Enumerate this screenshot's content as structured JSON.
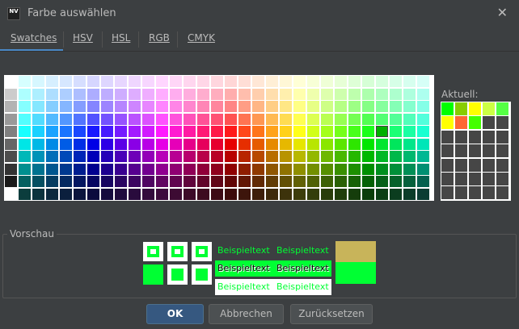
{
  "window": {
    "title": "Farbe auswählen",
    "app_icon_text": "NV"
  },
  "tabs": [
    {
      "label": "Swatches",
      "active": true
    },
    {
      "label": "HSV",
      "active": false
    },
    {
      "label": "HSL",
      "active": false
    },
    {
      "label": "RGB",
      "active": false
    },
    {
      "label": "CMYK",
      "active": false
    }
  ],
  "swatches": {
    "rows": 10,
    "cols": 31,
    "selected_color": "#00b000",
    "first_column_colors": [
      "#ffffff",
      "#cccccc",
      "#b3b3b3",
      "#999999",
      "#808080",
      "#666666",
      "#4d4d4d",
      "#333333",
      "#1a1a1a",
      "#ffffff"
    ]
  },
  "recent": {
    "label": "Aktuell:",
    "colors": [
      "#00ff00",
      "#88cc00",
      "#ffff00",
      "#ccff44",
      "#55ff44",
      "#ffff00",
      "#ff6633",
      "#44ff00"
    ],
    "empty_color": "#464646"
  },
  "preview": {
    "label": "Vorschau",
    "sample_text": "Beispieltext",
    "color": "#00ff33",
    "previous_color": "#c8b45a"
  },
  "buttons": {
    "ok": "OK",
    "cancel": "Abbrechen",
    "reset": "Zurücksetzen"
  }
}
